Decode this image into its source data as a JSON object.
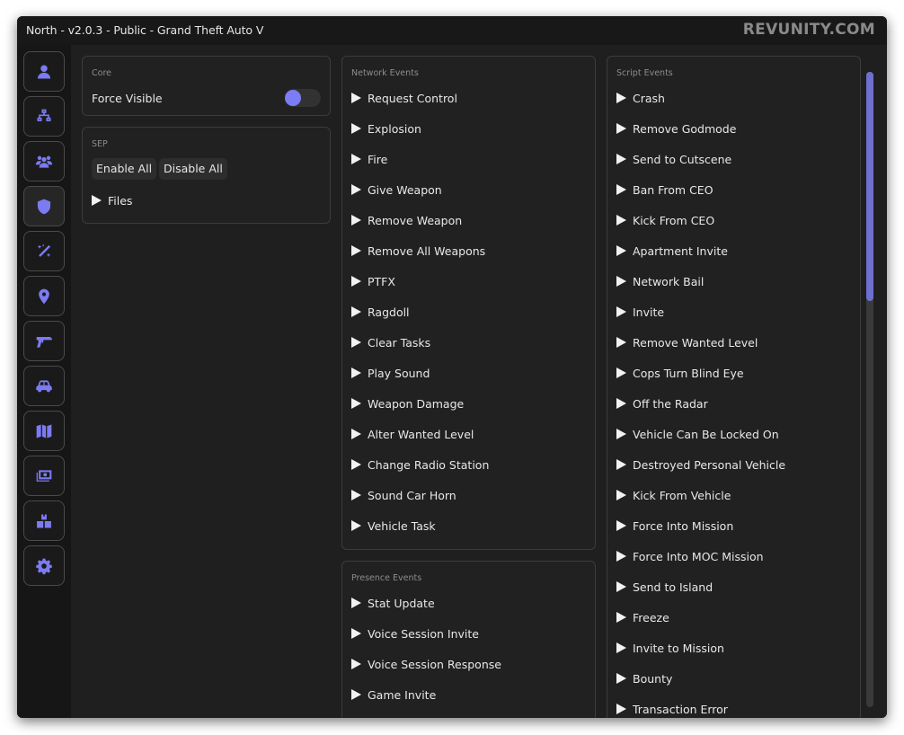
{
  "window": {
    "title": "North - v2.0.3 - Public - Grand Theft Auto V",
    "watermark": "REVUNITY.COM"
  },
  "theme": {
    "accent": "#7b7bf2",
    "scrollbar_thumb": "#6f6fd0",
    "background": "#1f1f1f",
    "panel": "#212121",
    "border": "#3c3c3c"
  },
  "sidebar": {
    "active_index": 3,
    "items": [
      {
        "icon": "user-icon",
        "name": "self"
      },
      {
        "icon": "network-icon",
        "name": "network"
      },
      {
        "icon": "players-icon",
        "name": "players"
      },
      {
        "icon": "shield-icon",
        "name": "protections"
      },
      {
        "icon": "magic-wand-icon",
        "name": "recovery"
      },
      {
        "icon": "location-pin-icon",
        "name": "teleport"
      },
      {
        "icon": "gun-icon",
        "name": "weapons"
      },
      {
        "icon": "car-icon",
        "name": "vehicles"
      },
      {
        "icon": "map-icon",
        "name": "world"
      },
      {
        "icon": "money-icon",
        "name": "money"
      },
      {
        "icon": "boxes-icon",
        "name": "spawner"
      },
      {
        "icon": "gear-icon",
        "name": "settings"
      }
    ]
  },
  "core": {
    "title": "Core",
    "force_visible_label": "Force Visible",
    "force_visible_on": false
  },
  "sep": {
    "title": "SEP",
    "enable_all": "Enable All",
    "disable_all": "Disable All",
    "files_label": "Files"
  },
  "network_events": {
    "title": "Network Events",
    "items": [
      "Request Control",
      "Explosion",
      "Fire",
      "Give Weapon",
      "Remove Weapon",
      "Remove All Weapons",
      "PTFX",
      "Ragdoll",
      "Clear Tasks",
      "Play Sound",
      "Weapon Damage",
      "Alter Wanted Level",
      "Change Radio Station",
      "Sound Car Horn",
      "Vehicle Task"
    ]
  },
  "presence_events": {
    "title": "Presence Events",
    "items": [
      "Stat Update",
      "Voice Session Invite",
      "Voice Session Response",
      "Game Invite"
    ]
  },
  "script_events": {
    "title": "Script Events",
    "items": [
      "Crash",
      "Remove Godmode",
      "Send to Cutscene",
      "Ban From CEO",
      "Kick From CEO",
      "Apartment Invite",
      "Network Bail",
      "Invite",
      "Remove Wanted Level",
      "Cops Turn Blind Eye",
      "Off the Radar",
      "Vehicle Can Be Locked On",
      "Destroyed Personal Vehicle",
      "Kick From Vehicle",
      "Force Into Mission",
      "Force Into MOC Mission",
      "Send to Island",
      "Freeze",
      "Invite to Mission",
      "Bounty",
      "Transaction Error"
    ],
    "scroll_position_fraction": 0.0,
    "visible_fraction": 0.36
  }
}
